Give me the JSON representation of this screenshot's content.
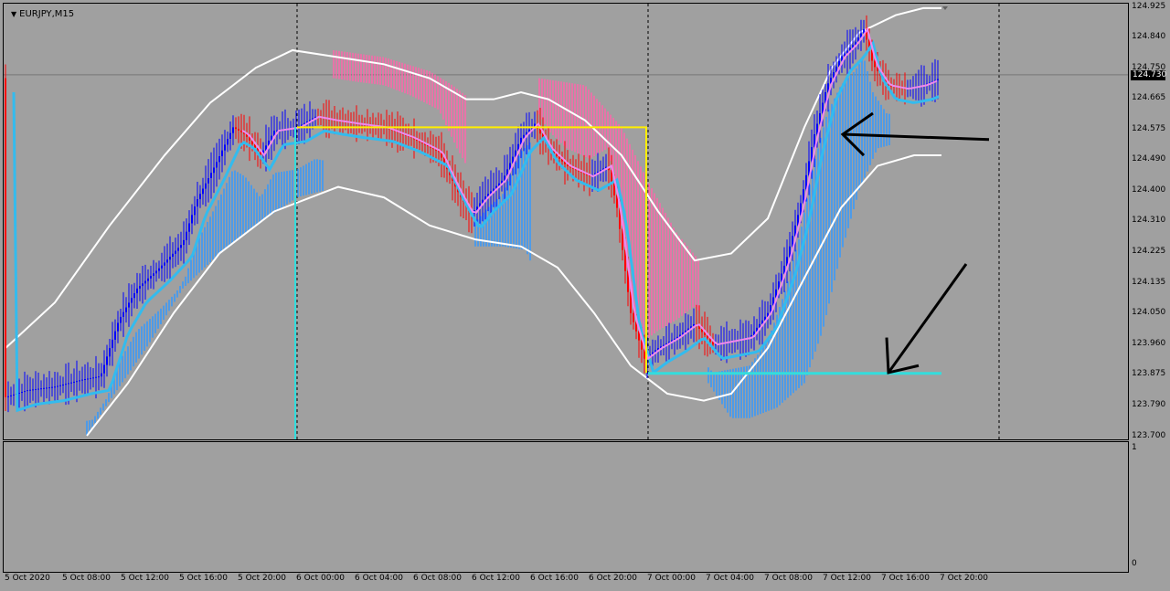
{
  "chart": {
    "symbol": "EURJPY,M15",
    "current_price": "124.730",
    "price_ticks": [
      "124.925",
      "124.840",
      "124.750",
      "124.665",
      "124.575",
      "124.490",
      "124.400",
      "124.310",
      "124.225",
      "124.135",
      "124.050",
      "123.960",
      "123.875",
      "123.790",
      "123.700"
    ],
    "time_ticks": [
      "5 Oct 2020",
      "5 Oct 08:00",
      "5 Oct 12:00",
      "5 Oct 16:00",
      "5 Oct 20:00",
      "6 Oct 00:00",
      "6 Oct 04:00",
      "6 Oct 08:00",
      "6 Oct 12:00",
      "6 Oct 16:00",
      "6 Oct 20:00",
      "7 Oct 00:00",
      "7 Oct 04:00",
      "7 Oct 08:00",
      "7 Oct 12:00",
      "7 Oct 16:00",
      "7 Oct 20:00"
    ],
    "subwindow_ticks": [
      "1",
      "0"
    ],
    "colors": {
      "background": "#a0a0a0",
      "bull_candle": "#0000ff",
      "bear_candle": "#ff0000",
      "envelope": "#ffffff",
      "fast_ma": "#33bbee",
      "slow_ma": "#ee88ee",
      "cloud_up": "#3399ff",
      "cloud_down": "#ff66aa",
      "box": "#ffee00",
      "level_line": "#33dddd",
      "arrow": "#000000"
    }
  }
}
